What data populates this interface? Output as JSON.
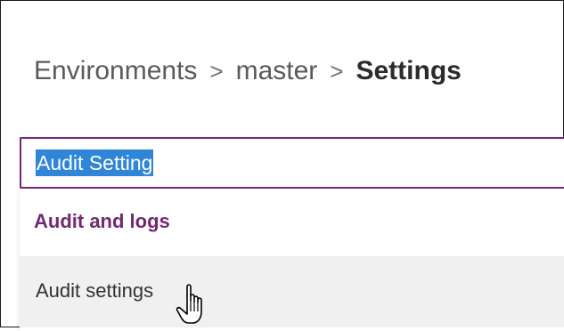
{
  "breadcrumb": {
    "items": [
      "Environments",
      "master"
    ],
    "separator": ">",
    "current": "Settings"
  },
  "search": {
    "value": "Audit Setting",
    "selected": true
  },
  "results": {
    "group_header": "Audit and logs",
    "items": [
      {
        "label": "Audit settings",
        "hovered": true
      }
    ]
  },
  "cursor": {
    "type": "hand-pointer-icon"
  },
  "colors": {
    "accent": "#742774",
    "selection": "#2f86d8",
    "hover_bg": "#f0f0f0"
  }
}
